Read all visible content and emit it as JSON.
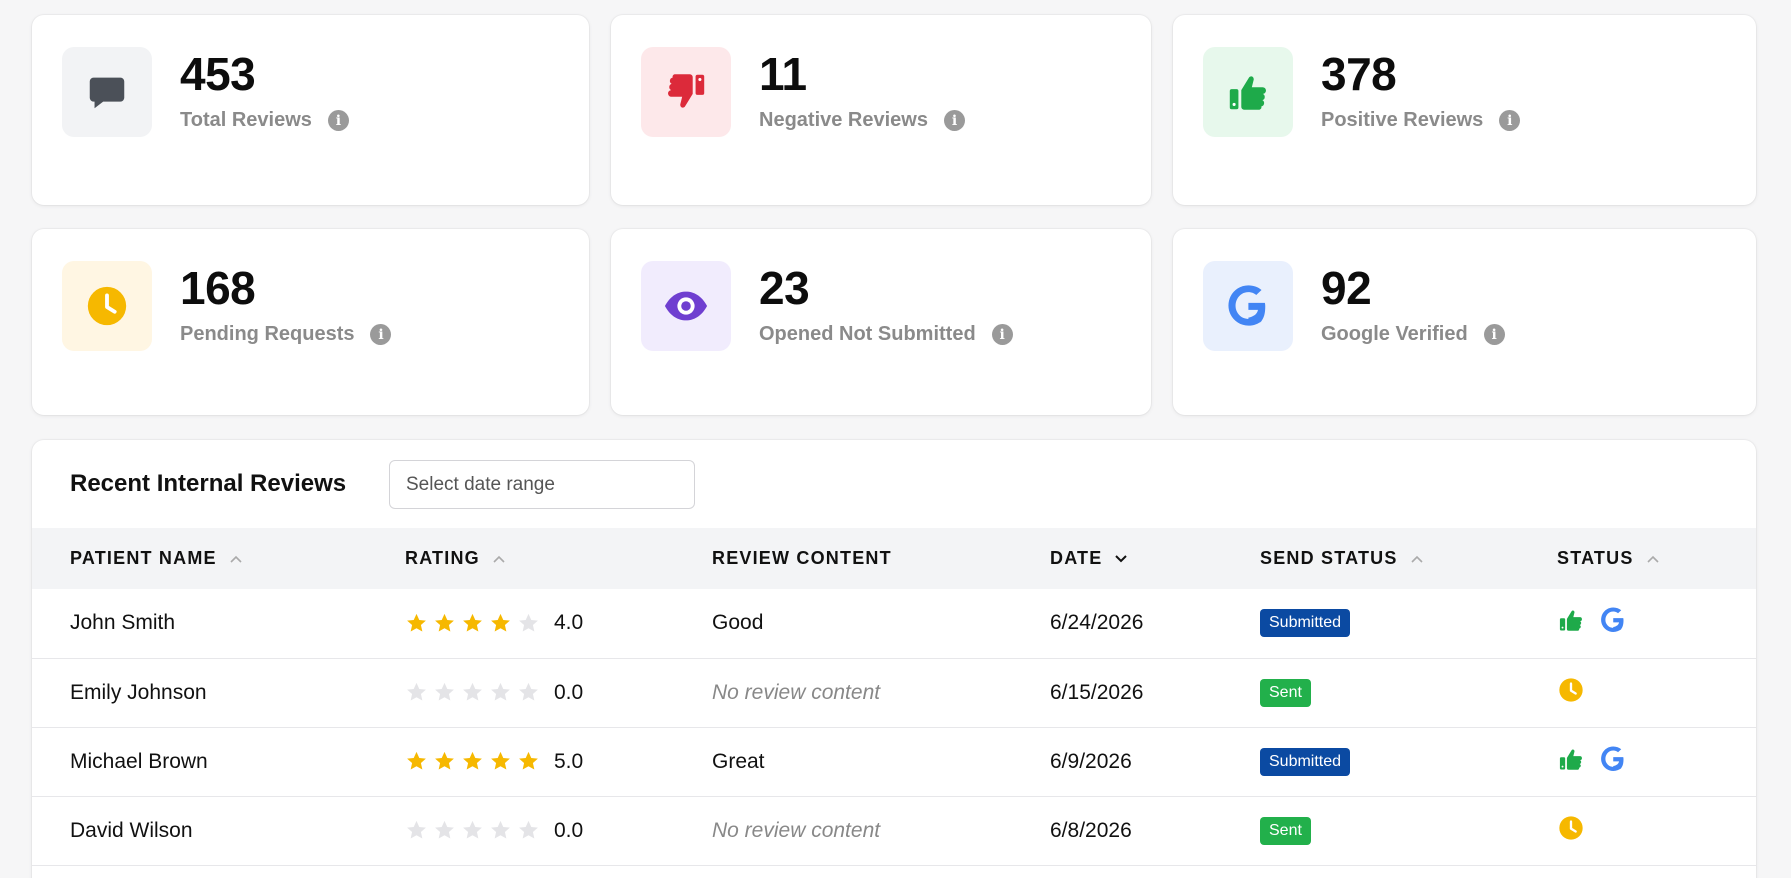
{
  "stats": [
    {
      "value": "453",
      "label": "Total Reviews",
      "icon": "chat-bubble-icon",
      "icon_color": "#4b5058",
      "bg": "#f2f3f5"
    },
    {
      "value": "11",
      "label": "Negative Reviews",
      "icon": "thumbs-down-icon",
      "icon_color": "#dc2a3a",
      "bg": "#fde8ea"
    },
    {
      "value": "378",
      "label": "Positive Reviews",
      "icon": "thumbs-up-icon",
      "icon_color": "#1eaa4a",
      "bg": "#e7f8ec"
    },
    {
      "value": "168",
      "label": "Pending Requests",
      "icon": "clock-icon",
      "icon_color": "#f6b800",
      "bg": "#fff6e3"
    },
    {
      "value": "23",
      "label": "Opened Not Submitted",
      "icon": "eye-icon",
      "icon_color": "#6f3fd0",
      "bg": "#f1ecfd"
    },
    {
      "value": "92",
      "label": "Google Verified",
      "icon": "google-icon",
      "icon_color": "#4285f4",
      "bg": "#e9f0fd"
    }
  ],
  "panel": {
    "title": "Recent Internal Reviews",
    "date_placeholder": "Select date range"
  },
  "table": {
    "columns": [
      {
        "label": "PATIENT NAME",
        "sort": "up"
      },
      {
        "label": "RATING",
        "sort": "up"
      },
      {
        "label": "REVIEW CONTENT",
        "sort": ""
      },
      {
        "label": "DATE",
        "sort": "down"
      },
      {
        "label": "SEND STATUS",
        "sort": "up"
      },
      {
        "label": "STATUS",
        "sort": "up"
      }
    ],
    "rows": [
      {
        "name": "John Smith",
        "stars": 4,
        "rating": "4.0",
        "content": "Good",
        "content_empty": false,
        "date": "6/24/2026",
        "send_status": "Submitted",
        "status_icons": [
          "thumbs-up-icon",
          "google-icon"
        ]
      },
      {
        "name": "Emily Johnson",
        "stars": 0,
        "rating": "0.0",
        "content": "No review content",
        "content_empty": true,
        "date": "6/15/2026",
        "send_status": "Sent",
        "status_icons": [
          "clock-icon"
        ]
      },
      {
        "name": "Michael Brown",
        "stars": 5,
        "rating": "5.0",
        "content": "Great",
        "content_empty": false,
        "date": "6/9/2026",
        "send_status": "Submitted",
        "status_icons": [
          "thumbs-up-icon",
          "google-icon"
        ]
      },
      {
        "name": "David Wilson",
        "stars": 0,
        "rating": "0.0",
        "content": "No review content",
        "content_empty": true,
        "date": "6/8/2026",
        "send_status": "Sent",
        "status_icons": [
          "clock-icon"
        ]
      }
    ]
  },
  "colors": {
    "star_filled": "#f6b800",
    "star_empty": "#e4e4e7",
    "badge_submitted": "#0b4aa2",
    "badge_sent": "#22b04b",
    "status_thumb": "#1eaa4a",
    "status_google": "#4285f4",
    "status_clock": "#f6b800"
  }
}
